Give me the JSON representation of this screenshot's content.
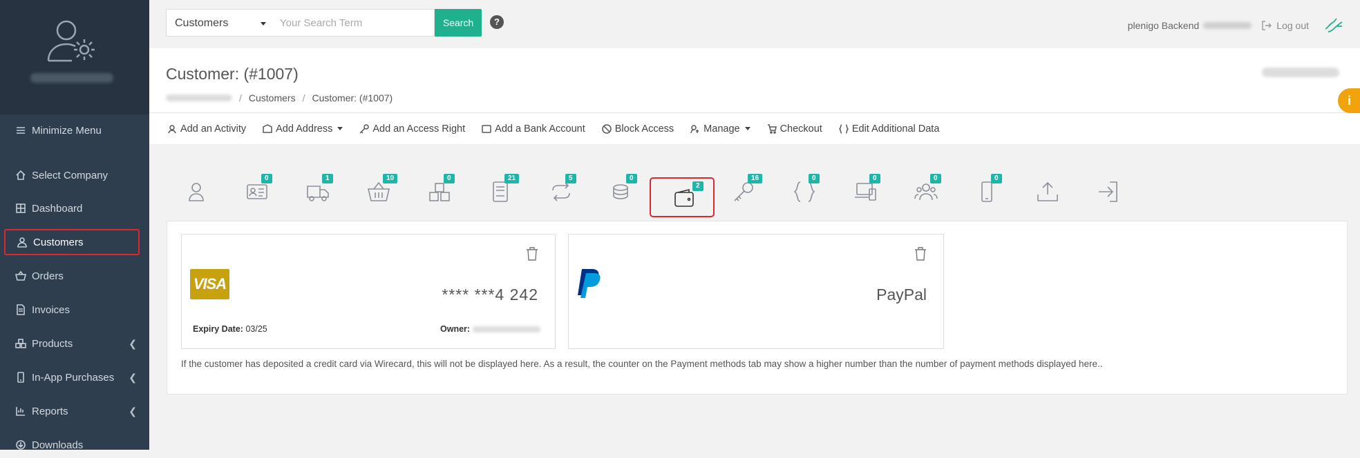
{
  "sidebar": {
    "items": [
      {
        "label": "Minimize Menu",
        "icon": "menu-icon"
      },
      {
        "label": "Select Company",
        "icon": "home-icon"
      },
      {
        "label": "Dashboard",
        "icon": "grid-icon"
      },
      {
        "label": "Customers",
        "icon": "user-icon",
        "active": true
      },
      {
        "label": "Orders",
        "icon": "basket-icon"
      },
      {
        "label": "Invoices",
        "icon": "document-icon"
      },
      {
        "label": "Products",
        "icon": "boxes-icon",
        "expandable": true
      },
      {
        "label": "In-App Purchases",
        "icon": "phone-icon",
        "expandable": true
      },
      {
        "label": "Reports",
        "icon": "chart-icon",
        "expandable": true
      },
      {
        "label": "Downloads",
        "icon": "download-icon"
      }
    ]
  },
  "topbar": {
    "search_type": "Customers",
    "search_placeholder": "Your Search Term",
    "search_button": "Search",
    "help": "?",
    "backend_label": "plenigo Backend",
    "logout": "Log out"
  },
  "header": {
    "title": "Customer: (#1007)",
    "breadcrumb": [
      "Customers",
      "Customer: (#1007)"
    ]
  },
  "info_tab": "i",
  "actions": [
    {
      "label": "Add an Activity",
      "icon": "activity-icon"
    },
    {
      "label": "Add Address",
      "icon": "address-icon",
      "dropdown": true
    },
    {
      "label": "Add an Access Right",
      "icon": "key-icon"
    },
    {
      "label": "Add a Bank Account",
      "icon": "bank-account-icon"
    },
    {
      "label": "Block Access",
      "icon": "block-icon"
    },
    {
      "label": "Manage",
      "icon": "manage-icon",
      "dropdown": true
    },
    {
      "label": "Checkout",
      "icon": "cart-icon"
    },
    {
      "label": "Edit Additional Data",
      "icon": "braces-icon"
    }
  ],
  "tabs": [
    {
      "name": "profile",
      "badge": null
    },
    {
      "name": "id-card",
      "badge": "0"
    },
    {
      "name": "delivery",
      "badge": "1"
    },
    {
      "name": "orders",
      "badge": "10"
    },
    {
      "name": "products",
      "badge": "0"
    },
    {
      "name": "invoices",
      "badge": "21"
    },
    {
      "name": "subscriptions",
      "badge": "5"
    },
    {
      "name": "coins",
      "badge": "0"
    },
    {
      "name": "payment-methods",
      "badge": "2",
      "active": true
    },
    {
      "name": "access-rights",
      "badge": "16"
    },
    {
      "name": "additional-data",
      "badge": "0"
    },
    {
      "name": "devices",
      "badge": "0"
    },
    {
      "name": "users",
      "badge": "0"
    },
    {
      "name": "app",
      "badge": "0"
    },
    {
      "name": "upload",
      "badge": null
    },
    {
      "name": "login",
      "badge": null
    }
  ],
  "payment_methods": {
    "visa": {
      "logo": "VISA",
      "number": "**** ***4 242",
      "expiry_label": "Expiry Date:",
      "expiry_value": "03/25",
      "owner_label": "Owner:"
    },
    "paypal": {
      "name": "PayPal"
    },
    "note": "If the customer has deposited a credit card via Wirecard, this will not be displayed here. As a result, the counter on the Payment methods tab may show a higher number than the number of payment methods displayed here.."
  },
  "colors": {
    "sidebar_bg": "#2f3e4e",
    "accent_green": "#1fb08e",
    "badge": "#1fb5a8",
    "highlight_red": "#e0262f",
    "visa_gold": "#c8a10f",
    "info_orange": "#f0a30a"
  }
}
